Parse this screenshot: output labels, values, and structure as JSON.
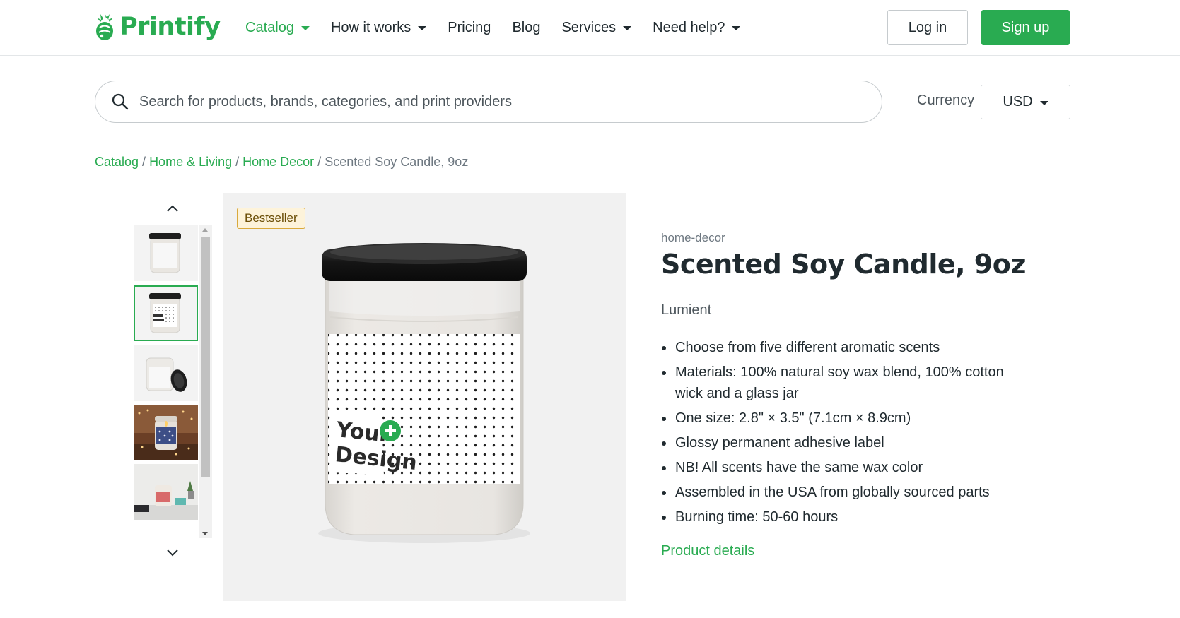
{
  "brand": {
    "name": "Printify",
    "color": "#29ab51"
  },
  "nav": {
    "items": [
      {
        "label": "Catalog",
        "dropdown": true,
        "active": true
      },
      {
        "label": "How it works",
        "dropdown": true,
        "active": false
      },
      {
        "label": "Pricing",
        "dropdown": false,
        "active": false
      },
      {
        "label": "Blog",
        "dropdown": false,
        "active": false
      },
      {
        "label": "Services",
        "dropdown": true,
        "active": false
      },
      {
        "label": "Need help?",
        "dropdown": true,
        "active": false
      }
    ],
    "login_label": "Log in",
    "signup_label": "Sign up"
  },
  "search": {
    "placeholder": "Search for products, brands, categories, and print providers",
    "value": "",
    "icon": "search-icon"
  },
  "currency": {
    "label": "Currency",
    "selected": "USD"
  },
  "breadcrumb": {
    "items": [
      "Catalog",
      "Home & Living",
      "Home Decor"
    ],
    "current": "Scented Soy Candle, 9oz",
    "separator": "/"
  },
  "gallery": {
    "thumbnail_count": 5,
    "selected_index": 1,
    "badge": "Bestseller",
    "image_label_line1": "Your",
    "image_label_line2": "Design"
  },
  "product": {
    "category": "home-decor",
    "title": "Scented Soy Candle, 9oz",
    "brand": "Lumient",
    "features": [
      "Choose from five different aromatic scents",
      "Materials: 100% natural soy wax blend, 100% cotton wick and a glass jar",
      "One size: 2.8\" × 3.5\" (7.1cm × 8.9cm)",
      "Glossy permanent adhesive label",
      "NB! All scents have the same wax color",
      "Assembled in the USA from globally sourced parts",
      "Burning time: 50-60 hours"
    ],
    "details_link": "Product details"
  },
  "colors": {
    "accent": "#29ab51",
    "text": "#202a2f",
    "muted": "#6e7881",
    "badge_bg": "#fdf3da",
    "badge_border": "#d9a93c"
  }
}
